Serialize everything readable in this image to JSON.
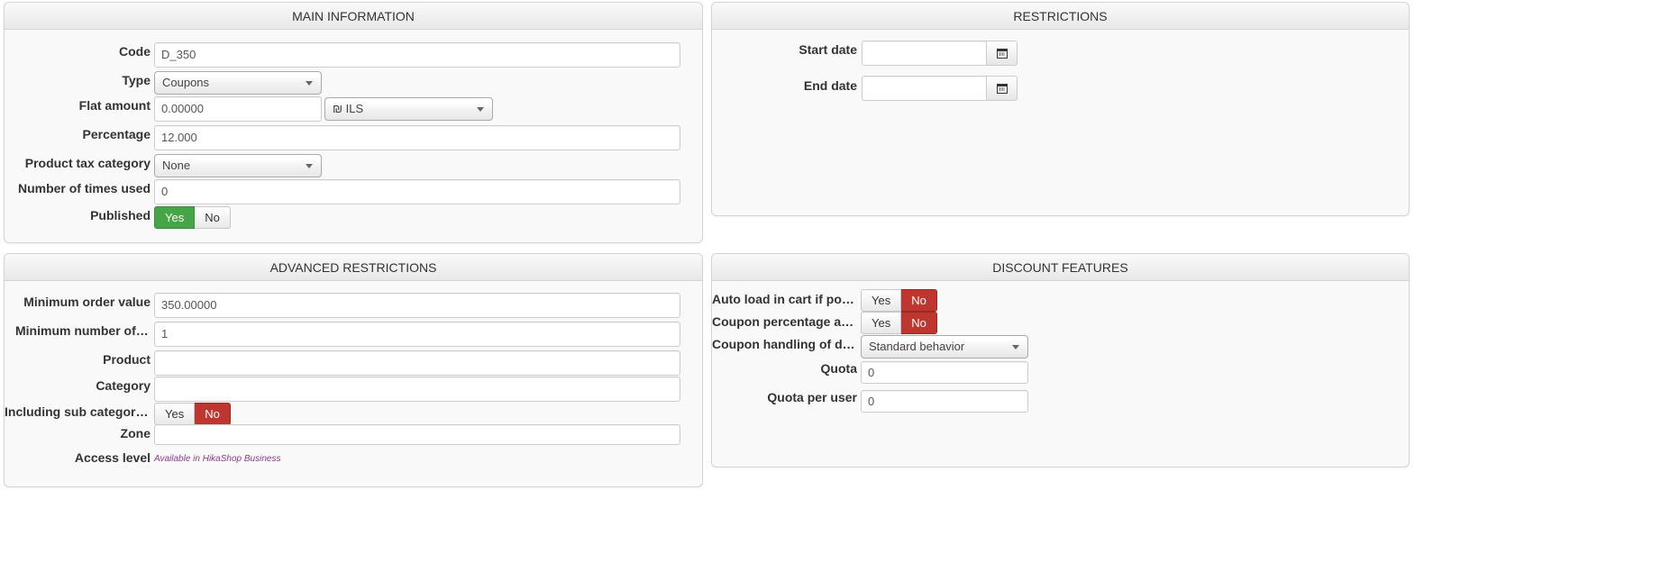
{
  "main_info": {
    "title": "MAIN INFORMATION",
    "code_label": "Code",
    "code_value": "D_350",
    "type_label": "Type",
    "type_value": "Coupons",
    "flat_amount_label": "Flat amount",
    "flat_amount_value": "0.00000",
    "currency_value": "₪ ILS",
    "percentage_label": "Percentage",
    "percentage_value": "12.000",
    "tax_category_label": "Product tax category",
    "tax_category_value": "None",
    "times_used_label": "Number of times used",
    "times_used_value": "0",
    "published_label": "Published",
    "published_yes": "Yes",
    "published_no": "No"
  },
  "restrictions": {
    "title": "RESTRICTIONS",
    "start_date_label": "Start date",
    "start_date_value": "",
    "end_date_label": "End date",
    "end_date_value": ""
  },
  "advanced": {
    "title": "ADVANCED RESTRICTIONS",
    "min_order_label": "Minimum order value",
    "min_order_value": "350.00000",
    "min_products_label": "Minimum number of prod…",
    "min_products_value": "1",
    "product_label": "Product",
    "product_value": "",
    "category_label": "Category",
    "category_value": "",
    "sub_categories_label": "Including sub categories",
    "sub_yes": "Yes",
    "sub_no": "No",
    "zone_label": "Zone",
    "zone_value": "",
    "access_level_label": "Access level",
    "access_level_note": "Available in HikaShop Business"
  },
  "discount_features": {
    "title": "DISCOUNT FEATURES",
    "auto_load_label": "Auto load in cart if possible",
    "auto_yes": "Yes",
    "auto_no": "No",
    "coupon_pct_label": "Coupon percentage applie…",
    "pct_yes": "Yes",
    "pct_no": "No",
    "handling_label": "Coupon handling of disco…",
    "handling_value": "Standard behavior",
    "quota_label": "Quota",
    "quota_value": "0",
    "quota_user_label": "Quota per user",
    "quota_user_value": "0"
  },
  "colors": {
    "active_green": "#46a546",
    "active_red": "#bd362f",
    "note_purple": "#8a3d8a"
  }
}
